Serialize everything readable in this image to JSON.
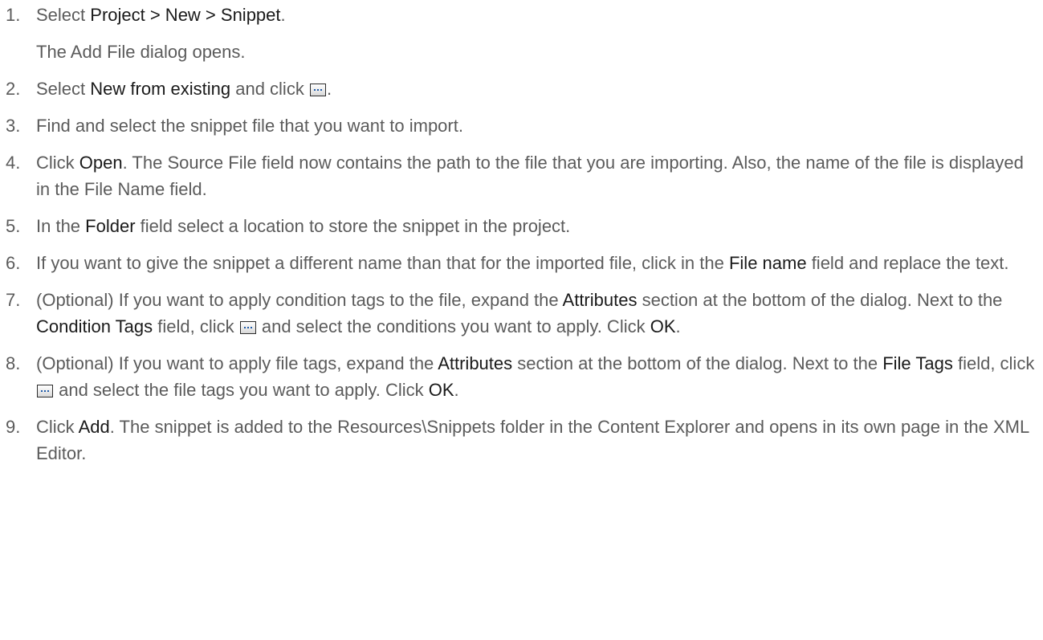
{
  "steps": [
    {
      "num": "1.",
      "s1": "Select ",
      "b1": "Project > New > Snippet",
      "s2": ".",
      "sub": "The Add File dialog opens."
    },
    {
      "num": "2.",
      "s1": "Select ",
      "b1": "New from existing",
      "s2": " and click ",
      "s3": "."
    },
    {
      "num": "3.",
      "s1": "Find and select the snippet file that you want to import."
    },
    {
      "num": "4.",
      "s1": "Click ",
      "b1": "Open",
      "s2": ". The Source File field now contains the path to the file that you are importing. Also, the name of the file is displayed in the File Name field."
    },
    {
      "num": "5.",
      "s1": "In the ",
      "b1": "Folder",
      "s2": " field select a location to store the snippet in the project."
    },
    {
      "num": "6.",
      "s1": "If you want to give the snippet a different name than that for the imported file, click in the ",
      "b1": "File name",
      "s2": " field and replace the text."
    },
    {
      "num": "7.",
      "s1": "(Optional) If you want to apply condition tags to the file, expand the ",
      "b1": "Attributes",
      "s2": " section at the bottom of the dialog. Next to the ",
      "b2": "Condition Tags",
      "s3": " field, click ",
      "s4": " and select the conditions you want to apply. Click ",
      "b3": "OK",
      "s5": "."
    },
    {
      "num": "8.",
      "s1": "(Optional) If you want to apply file tags, expand the ",
      "b1": "Attributes",
      "s2": " section at the bottom of the dialog. Next to the ",
      "b2": "File Tags",
      "s3": " field, click ",
      "s4": " and select the file tags you want to apply. Click ",
      "b3": "OK",
      "s5": "."
    },
    {
      "num": "9.",
      "s1": "Click ",
      "b1": "Add",
      "s2": ". The snippet is added to the Resources\\Snippets folder in the Content Explorer and opens in its own page in the XML Editor."
    }
  ],
  "icons": {
    "browse_button": "ellipsis-button-icon"
  }
}
